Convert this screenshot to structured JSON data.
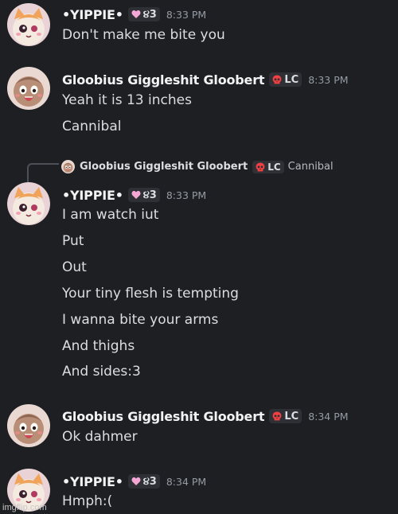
{
  "users": {
    "yippie": {
      "name": "•YIPPIE•",
      "tag_text": "૪3",
      "tag_icon": "heart-icon",
      "tag_color": "#f4a6d7"
    },
    "gloobius": {
      "name": "Gloobius Giggleshit Gloobert",
      "tag_text": "LC",
      "tag_icon": "skull-icon",
      "tag_color": "#f23f42"
    }
  },
  "messages": [
    {
      "author": "•YIPPIE•",
      "time": "8:33 PM",
      "lines": [
        "Don't make me bite you"
      ]
    },
    {
      "author": "Gloobius Giggleshit Gloobert",
      "time": "8:33 PM",
      "lines": [
        "Yeah it is 13 inches",
        "Cannibal"
      ]
    },
    {
      "author": "•YIPPIE•",
      "time": "8:33 PM",
      "reply": {
        "author": "Gloobius Giggleshit Gloobert",
        "tag_text": "LC",
        "text": "Cannibal"
      },
      "lines": [
        "I am watch iut",
        "Put",
        "Out",
        "Your tiny flesh is tempting",
        "I wanna bite your arms",
        "And thighs",
        "And sides:3"
      ]
    },
    {
      "author": "Gloobius Giggleshit Gloobert",
      "time": "8:34 PM",
      "lines": [
        "Ok dahmer"
      ]
    },
    {
      "author": "•YIPPIE•",
      "time": "8:34 PM",
      "lines": [
        "Hmph:("
      ]
    }
  ],
  "watermark": "imgflip.com",
  "colors": {
    "background": "#1e1f22",
    "text": "#dbdee1",
    "timestamp": "#949ba4"
  }
}
